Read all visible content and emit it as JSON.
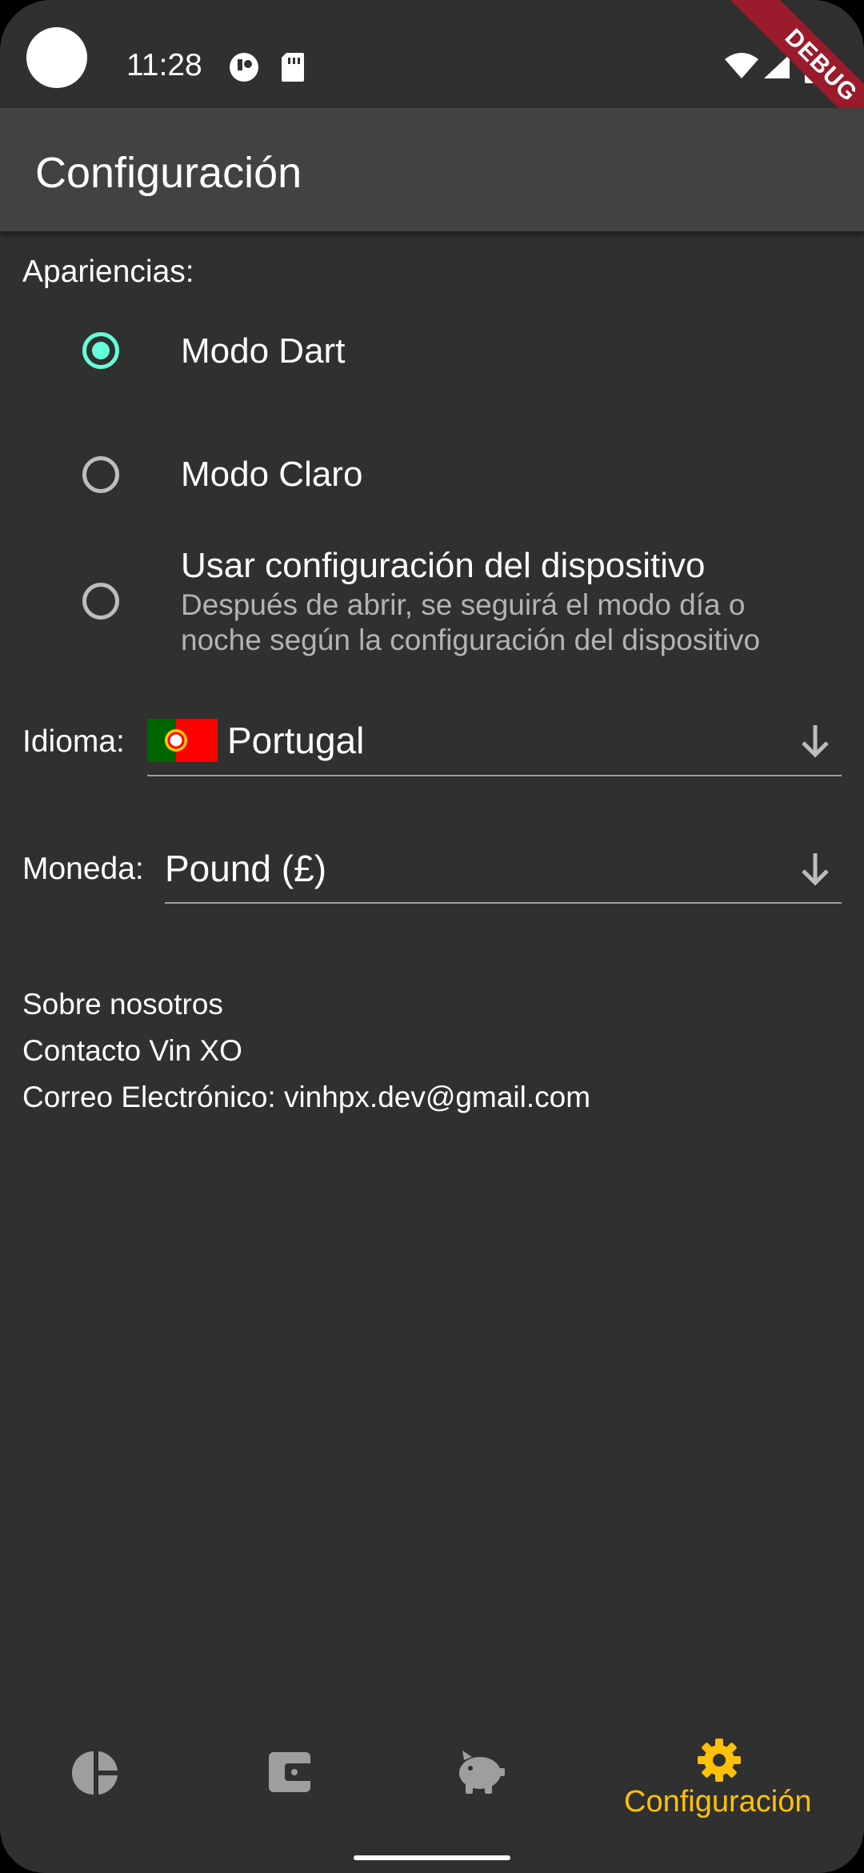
{
  "status_bar": {
    "time": "11:28",
    "debug_label": "DEBUG"
  },
  "app_bar": {
    "title": "Configuración"
  },
  "appearance": {
    "label": "Apariencias:",
    "options": [
      {
        "title": "Modo Dart",
        "subtitle": "",
        "selected": true
      },
      {
        "title": "Modo Claro",
        "subtitle": "",
        "selected": false
      },
      {
        "title": "Usar configuración del dispositivo",
        "subtitle": "Después de abrir, se seguirá el modo día o noche según la configuración del dispositivo",
        "selected": false
      }
    ]
  },
  "language": {
    "label": "Idioma:",
    "value": "Portugal",
    "flag_icon": "portugal-flag-icon"
  },
  "currency": {
    "label": "Moneda:",
    "value": "Pound (£)"
  },
  "about": {
    "title": "Sobre nosotros",
    "contact": "Contacto Vin XO",
    "email": "Correo Electrónico: vinhpx.dev@gmail.com"
  },
  "bottom_nav": {
    "items": [
      {
        "icon": "pie-chart-icon",
        "label": ""
      },
      {
        "icon": "wallet-icon",
        "label": ""
      },
      {
        "icon": "piggy-bank-icon",
        "label": ""
      },
      {
        "icon": "gear-icon",
        "label": "Configuración",
        "active": true
      }
    ]
  },
  "colors": {
    "accent": "#64ffda",
    "active_nav": "#ffc107",
    "background": "#303030",
    "app_bar": "#424242"
  }
}
